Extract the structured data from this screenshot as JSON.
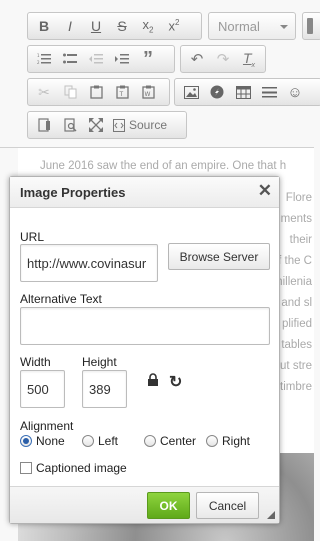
{
  "toolbar": {
    "format_combo": "Normal",
    "source_label": "Source"
  },
  "content": {
    "line1": "June 2016 saw the end of an empire. One that h",
    "fragments": [
      "Flore",
      "ments",
      "their",
      "f the C",
      "millenia",
      "and sl",
      "plified",
      "tables",
      "ut stre",
      "timbre"
    ]
  },
  "dialog": {
    "title": "Image Properties",
    "url_label": "URL",
    "url_value": "http://www.covinasur",
    "browse_label": "Browse Server",
    "alt_label": "Alternative Text",
    "alt_value": "",
    "width_label": "Width",
    "width_value": "500",
    "height_label": "Height",
    "height_value": "389",
    "alignment_label": "Alignment",
    "align_none": "None",
    "align_left": "Left",
    "align_center": "Center",
    "align_right": "Right",
    "captioned_label": "Captioned image",
    "ok_label": "OK",
    "cancel_label": "Cancel"
  },
  "colors": {
    "ok_button": "#6fba27",
    "radio_selected": "#2a5ea8"
  }
}
